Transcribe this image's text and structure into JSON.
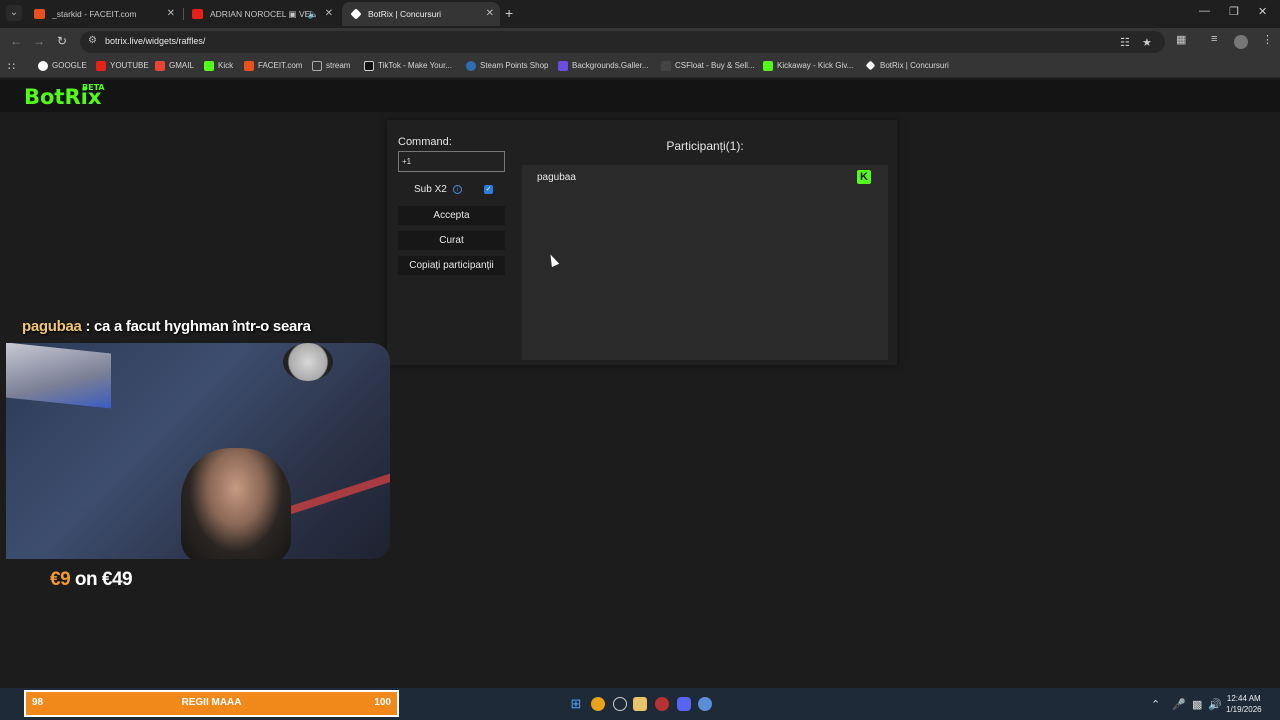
{
  "browser": {
    "tabs": [
      {
        "label": "_starkid - FACEIT.com",
        "color": "#e8511c"
      },
      {
        "label": "ADRIAN NOROCEL ▣ VE",
        "color": "#e62117"
      },
      {
        "label": "BotRix | Concursuri",
        "color": "#ffffff"
      }
    ],
    "url": "botrix.live/widgets/raffles/",
    "bookmarks": [
      {
        "label": "GOOGLE",
        "color": "#ffffff"
      },
      {
        "label": "YOUTUBE",
        "color": "#e62117"
      },
      {
        "label": "GMAIL",
        "color": "#ea4335"
      },
      {
        "label": "Kick",
        "color": "#53fc18"
      },
      {
        "label": "FACEIT.com",
        "color": "#e8511c"
      },
      {
        "label": "stream",
        "color": "#aaaaaa"
      },
      {
        "label": "TikTok - Make Your...",
        "color": "#000000"
      },
      {
        "label": "Steam Points Shop",
        "color": "#2a6fb3"
      },
      {
        "label": "Backgrounds.Galler...",
        "color": "#6a4de0"
      },
      {
        "label": "CSFloat - Buy & Sell...",
        "color": "#444444"
      },
      {
        "label": "Kickaway - Kick Giv...",
        "color": "#53fc18"
      },
      {
        "label": "BotRix | Concursuri",
        "color": "#ffffff"
      }
    ]
  },
  "app": {
    "logo": "BotRix",
    "logo_badge": "BETA",
    "command_label": "Command:",
    "command_value": "+1",
    "sub_label": "Sub X2",
    "sub_checked": true,
    "buttons": {
      "accept": "Accepta",
      "clear": "Curat",
      "copy": "Copiați participanții"
    },
    "participants_title": "Participanți(1):",
    "participants": [
      {
        "name": "pagubaa",
        "platform": "kick-icon"
      }
    ],
    "accent": "#53fc18"
  },
  "overlay": {
    "chat_user": "pagubaa",
    "chat_message": ": ca a facut hyghman într-o seara",
    "stake_amount": "€9",
    "stake_rest": "on €49",
    "goal_left": "98",
    "goal_title": "REGII MAAA",
    "goal_right": "100",
    "goal_color": "#f0881a"
  },
  "taskbar": {
    "time": "12:44 AM",
    "date": "1/19/2026"
  }
}
